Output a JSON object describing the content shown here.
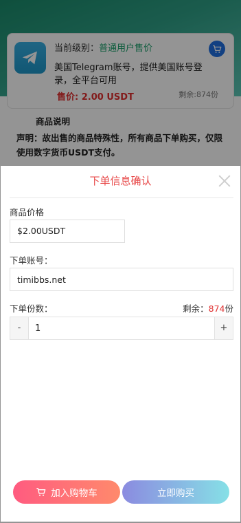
{
  "background_page": {
    "level_label": "当前级别：",
    "level_value": "普通用户售价",
    "product_title": "美国Telegram账号，提供美国账号登录，全平台可用",
    "price": "售价: 2.00 USDT",
    "stock": "剩余:874份",
    "desc_title": "商品说明",
    "desc_text": "声明：故出售的商品特殊性，所有商品下单购买，仅限使用数字货币USDT支付。"
  },
  "order_sheet": {
    "title": "下单信息确认",
    "price_label": "商品价格",
    "price_value": "$2.00USDT",
    "account_label": "下单账号：",
    "account_value": "timibbs.net",
    "quantity_label": "下单份数：",
    "stock_prefix": "剩余：",
    "stock_count": "874",
    "stock_suffix": "份",
    "minus_label": "-",
    "plus_label": "+",
    "quantity_value": "1",
    "add_to_cart_label": "加入购物车",
    "buy_now_label": "立即购买"
  },
  "colors": {
    "accent_red": "#e84a4a",
    "level_green": "#1aa06b",
    "cart_gradient_start": "#ff5b80",
    "buy_gradient_end": "#86e0e6"
  },
  "icons": {
    "product_logo": "telegram-icon",
    "cart_badge": "cart-icon",
    "close": "close-icon"
  }
}
